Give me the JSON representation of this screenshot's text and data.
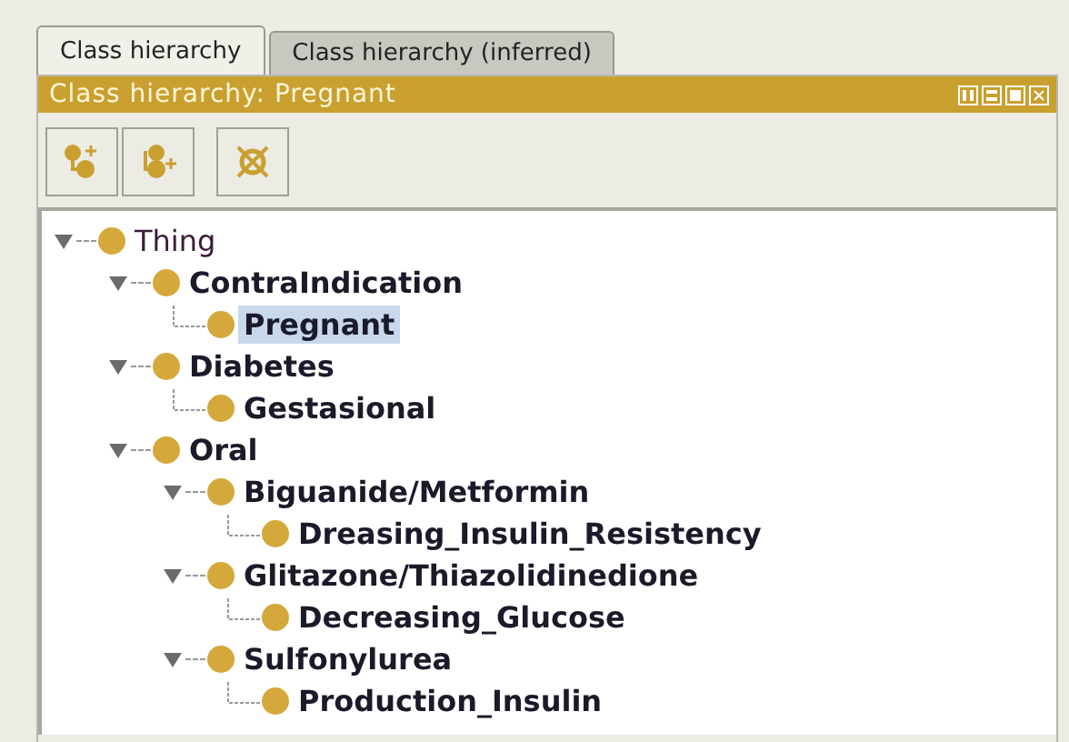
{
  "tabs": [
    {
      "label": "Class hierarchy",
      "selected": true
    },
    {
      "label": "Class hierarchy (inferred)",
      "selected": false
    }
  ],
  "view_title": "Class hierarchy: Pregnant",
  "tree": [
    {
      "label": "Thing",
      "expanded": true,
      "selected": false,
      "children": [
        {
          "label": "ContraIndication",
          "expanded": true,
          "selected": false,
          "children": [
            {
              "label": "Pregnant",
              "selected": true
            }
          ]
        },
        {
          "label": "Diabetes",
          "expanded": true,
          "selected": false,
          "children": [
            {
              "label": "Gestasional",
              "selected": false
            }
          ]
        },
        {
          "label": "Oral",
          "expanded": true,
          "selected": false,
          "children": [
            {
              "label": "Biguanide/Metformin",
              "expanded": true,
              "selected": false,
              "children": [
                {
                  "label": "Dreasing_Insulin_Resistency",
                  "selected": false
                }
              ]
            },
            {
              "label": "Glitazone/Thiazolidinedione",
              "expanded": true,
              "selected": false,
              "children": [
                {
                  "label": "Decreasing_Glucose",
                  "selected": false
                }
              ]
            },
            {
              "label": "Sulfonylurea",
              "expanded": true,
              "selected": false,
              "children": [
                {
                  "label": "Production_Insulin",
                  "selected": false
                }
              ]
            }
          ]
        }
      ]
    }
  ]
}
